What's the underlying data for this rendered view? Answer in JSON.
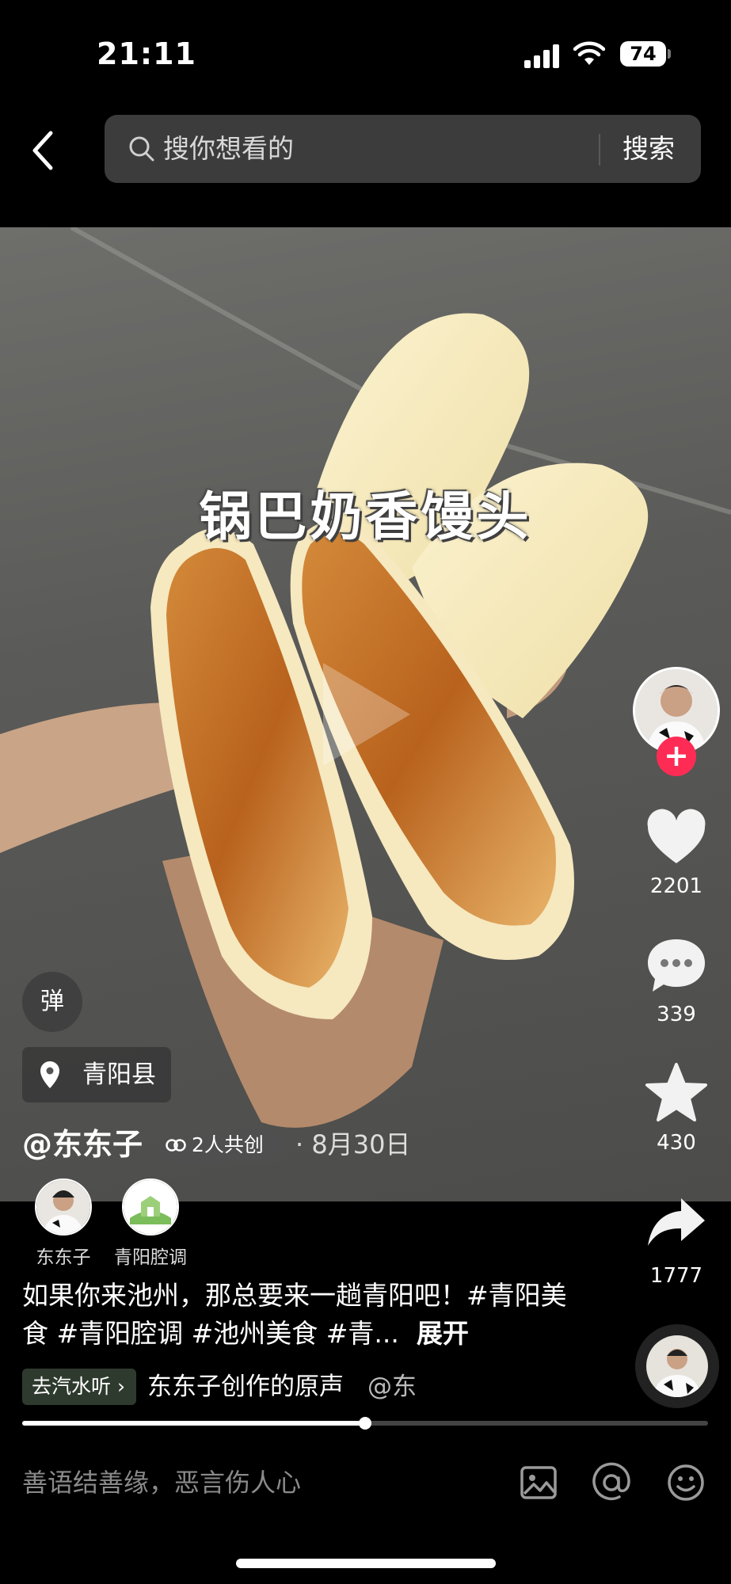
{
  "status_bar": {
    "time": "21:11",
    "battery": "74"
  },
  "search": {
    "placeholder": "搜你想看的",
    "button_label": "搜索"
  },
  "video": {
    "caption": "锅巴奶香馒头"
  },
  "overlay": {
    "danmaku_label": "弹",
    "location": "青阳县",
    "author": "@东东子",
    "cocreate_label": "2人共创",
    "date": "· 8月30日"
  },
  "right_rail": {
    "likes": "2201",
    "comments": "339",
    "favorites": "430",
    "shares": "1777"
  },
  "cocreators": [
    {
      "name": "东东子"
    },
    {
      "name": "青阳腔调"
    }
  ],
  "description": {
    "text": "如果你来池州，那总要来一趟青阳吧！#青阳美食 #青阳腔调 #池州美食 #青...",
    "expand_label": "展开"
  },
  "music": {
    "chip_label": "去汽水听 ›",
    "title": "东东子创作的原声",
    "mention": "@东"
  },
  "playback": {
    "progress": 0.5
  },
  "comment_bar": {
    "placeholder": "善语结善缘，恶言伤人心"
  },
  "colors": {
    "follow": "#fe2c55",
    "background": "#000000"
  }
}
